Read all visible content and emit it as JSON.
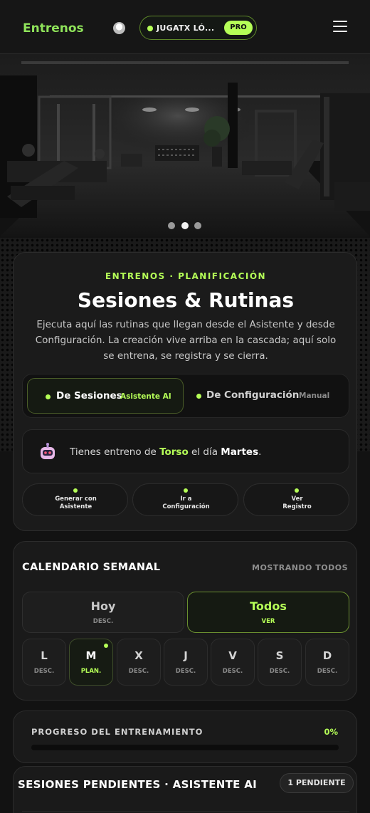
{
  "header": {
    "brand": "Entrenos",
    "username": "JUGATX LÓ...",
    "plan_badge": "PRO",
    "accent_color": "#b5ff57"
  },
  "hero": {
    "slides_total": 3,
    "active_slide": 2
  },
  "overview": {
    "eyebrow": "ENTRENOS · PLANIFICACIÓN",
    "title": "Sesiones & Rutinas",
    "description": "Ejecuta aquí las rutinas que llegan desde el Asistente y desde Configuración. La creación vive arriba en la cascada; aquí solo se entrena, se registra y se cierra.",
    "tabs": [
      {
        "label": "De Sesiones",
        "sub": "Asistente AI"
      },
      {
        "label": "De Configuración",
        "sub": "Manual"
      }
    ],
    "notice": {
      "prefix": "Tienes entreno de ",
      "focus": "Torso",
      "middle": " el día ",
      "day": "Martes",
      "suffix": "."
    },
    "actions": [
      {
        "label": "Generar con\nAsistente"
      },
      {
        "label": "Ir a\nConfiguración"
      },
      {
        "label": "Ver\nRegistro"
      }
    ]
  },
  "calendar": {
    "title": "CALENDARIO SEMANAL",
    "filter_status": "MOSTRANDO TODOS",
    "ranges": [
      {
        "label": "Hoy",
        "sub": "DESC."
      },
      {
        "label": "Todos",
        "sub": "VER"
      }
    ],
    "days": [
      {
        "letter": "L",
        "status": "DESC."
      },
      {
        "letter": "M",
        "status": "PLAN."
      },
      {
        "letter": "X",
        "status": "DESC."
      },
      {
        "letter": "J",
        "status": "DESC."
      },
      {
        "letter": "V",
        "status": "DESC."
      },
      {
        "letter": "S",
        "status": "DESC."
      },
      {
        "letter": "D",
        "status": "DESC."
      }
    ]
  },
  "progress": {
    "label": "PROGRESO DEL ENTRENAMIENTO",
    "percent_text": "0%",
    "value": 0
  },
  "pending": {
    "title": "SESIONES PENDIENTES · ASISTENTE AI",
    "badge": "1 PENDIENTE"
  }
}
